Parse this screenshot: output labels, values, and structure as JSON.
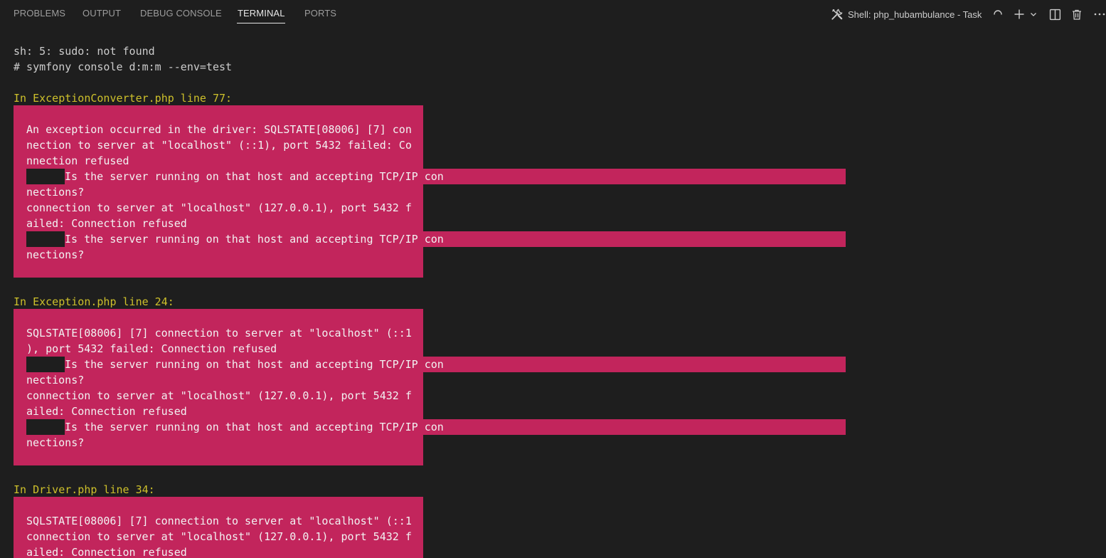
{
  "panel": {
    "tabs": [
      {
        "label": "PROBLEMS"
      },
      {
        "label": "OUTPUT"
      },
      {
        "label": "DEBUG CONSOLE"
      },
      {
        "label": "TERMINAL"
      },
      {
        "label": "PORTS"
      }
    ],
    "active_tab": "TERMINAL",
    "shell_label": "Shell: php_hubambulance - Task",
    "icons": [
      "tools-icon",
      "loading-spinner-icon",
      "plus-icon",
      "chevron-down-icon",
      "split-terminal-icon",
      "trash-icon",
      "more-icon"
    ]
  },
  "terminal": {
    "lines": [
      "sh: 5: sudo: not found",
      "# symfony console d:m:m --env=test"
    ],
    "blocks": [
      {
        "header": "In ExceptionConverter.php line 77:",
        "lines": [
          "An exception occurred in the driver: SQLSTATE[08006] [7] con",
          "nection to server at \"localhost\" (::1), port 5432 failed: Co",
          "nnection refused",
          "Is the server running on that host and accepting TCP/IP con",
          "nections?",
          "connection to server at \"localhost\" (127.0.0.1), port 5432 f",
          "ailed: Connection refused",
          "Is the server running on that host and accepting TCP/IP con",
          "nections?"
        ]
      },
      {
        "header": "In Exception.php line 24:",
        "lines": [
          "SQLSTATE[08006] [7] connection to server at \"localhost\" (::1",
          "), port 5432 failed: Connection refused",
          "Is the server running on that host and accepting TCP/IP con",
          "nections?",
          "connection to server at \"localhost\" (127.0.0.1), port 5432 f",
          "ailed: Connection refused",
          "Is the server running on that host and accepting TCP/IP con",
          "nections?"
        ]
      },
      {
        "header": "In Driver.php line 34:",
        "lines": [
          "SQLSTATE[08006] [7] connection to server at \"localhost\" (::1",
          "connection to server at \"localhost\" (127.0.0.1), port 5432 f",
          "ailed: Connection refused"
        ]
      }
    ]
  },
  "colors": {
    "background": "#1e1e1e",
    "error_bg": "#c2255c",
    "header_yellow": "#cdc02b",
    "text": "#cccccc"
  }
}
